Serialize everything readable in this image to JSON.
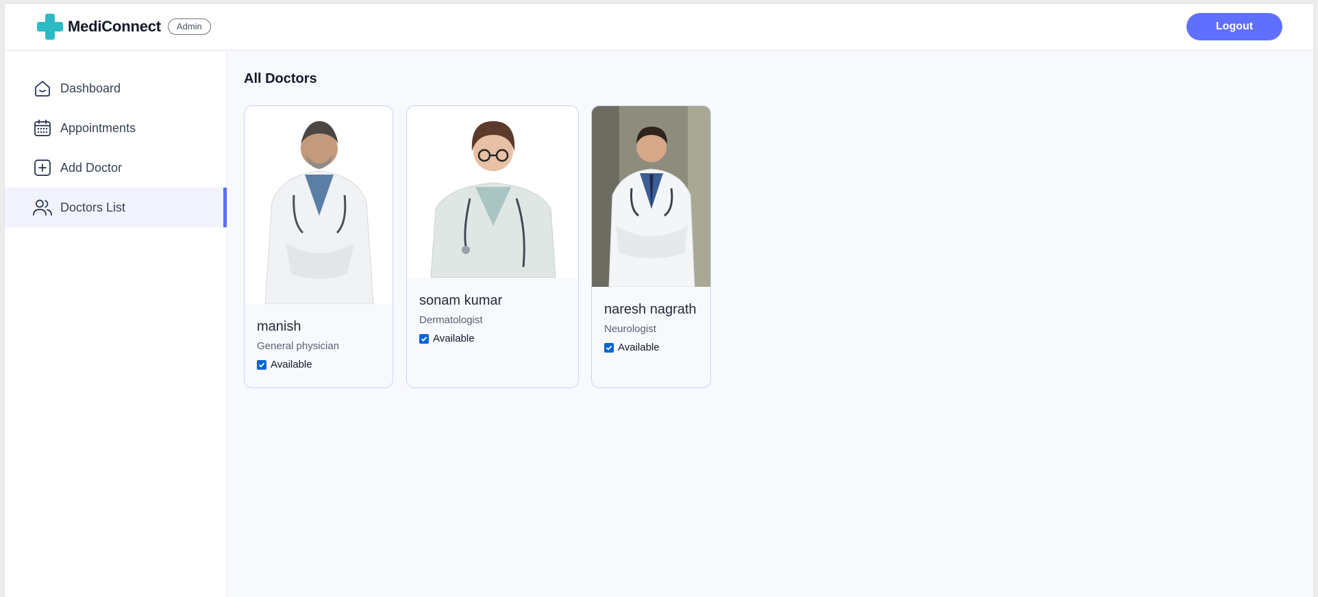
{
  "header": {
    "brand": "MediConnect",
    "badge": "Admin",
    "logout_label": "Logout",
    "brand_color": "#2cbac5",
    "accent_color": "#5f6fff"
  },
  "sidebar": {
    "items": [
      {
        "label": "Dashboard",
        "icon": "home-icon",
        "active": false
      },
      {
        "label": "Appointments",
        "icon": "calendar-icon",
        "active": false
      },
      {
        "label": "Add Doctor",
        "icon": "add-square-icon",
        "active": false
      },
      {
        "label": "Doctors List",
        "icon": "people-icon",
        "active": true
      }
    ]
  },
  "main": {
    "title": "All Doctors",
    "doctors": [
      {
        "name": "manish",
        "speciality": "General physician",
        "available": true,
        "available_label": "Available"
      },
      {
        "name": "sonam kumar",
        "speciality": "Dermatologist",
        "available": true,
        "available_label": "Available"
      },
      {
        "name": "naresh nagrath",
        "speciality": "Neurologist",
        "available": true,
        "available_label": "Available"
      }
    ]
  }
}
